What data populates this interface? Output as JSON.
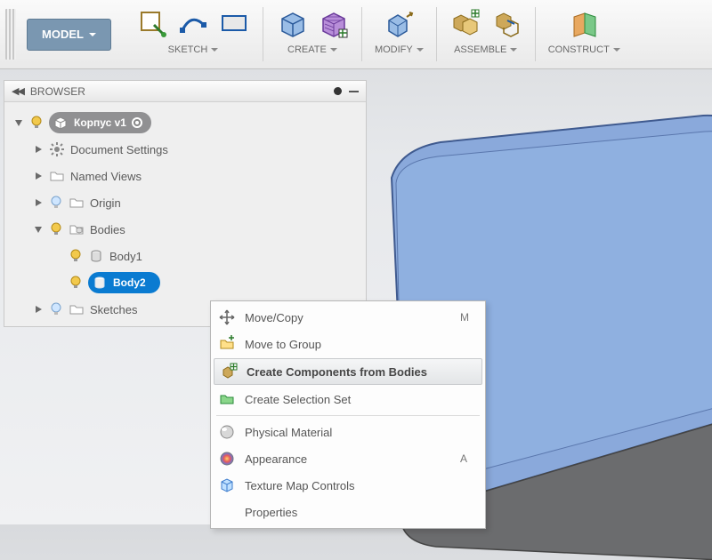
{
  "toolbar": {
    "mode_label": "MODEL",
    "groups": {
      "sketch": "SKETCH",
      "create": "CREATE",
      "modify": "MODIFY",
      "assemble": "ASSEMBLE",
      "construct": "CONSTRUCT"
    }
  },
  "browser": {
    "title": "BROWSER",
    "root": "Корпус v1",
    "items": {
      "doc_settings": "Document Settings",
      "named_views": "Named Views",
      "origin": "Origin",
      "bodies": "Bodies",
      "body1": "Body1",
      "body2": "Body2",
      "sketches": "Sketches"
    }
  },
  "context_menu": {
    "move_copy": {
      "label": "Move/Copy",
      "shortcut": "M"
    },
    "move_to_group": {
      "label": "Move to Group"
    },
    "create_components": {
      "label": "Create Components from Bodies"
    },
    "create_selection_set": {
      "label": "Create Selection Set"
    },
    "physical_material": {
      "label": "Physical Material"
    },
    "appearance": {
      "label": "Appearance",
      "shortcut": "A"
    },
    "texture_map": {
      "label": "Texture Map Controls"
    },
    "properties": {
      "label": "Properties"
    }
  },
  "colors": {
    "accent_blue": "#0a7bd1",
    "model_top": "#8aa9db",
    "model_side": "#6b6c6e"
  }
}
